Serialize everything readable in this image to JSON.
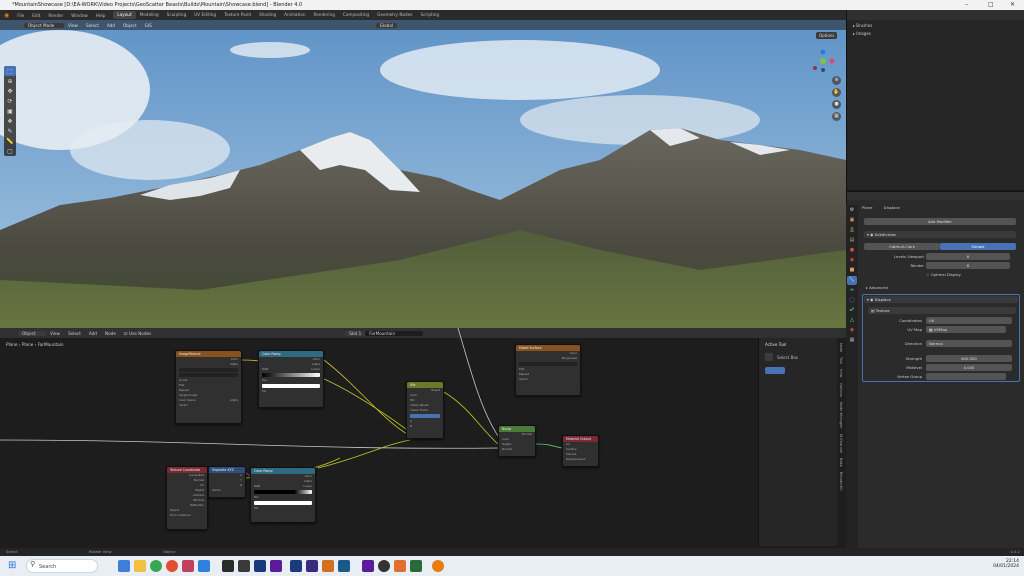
{
  "window": {
    "title": "*MountainShowcase [D:\\EA-WORK\\Video Projects\\GeoScatter Beasts\\Builds\\Mountain\\Showcase.blend] - Blender 4.0"
  },
  "menu": [
    "File",
    "Edit",
    "Render",
    "Window",
    "Help"
  ],
  "workspaces": [
    {
      "label": "Layout",
      "active": true
    },
    {
      "label": "Modeling"
    },
    {
      "label": "Sculpting"
    },
    {
      "label": "UV Editing"
    },
    {
      "label": "Texture Paint"
    },
    {
      "label": "Shading"
    },
    {
      "label": "Animation"
    },
    {
      "label": "Rendering"
    },
    {
      "label": "Compositing"
    },
    {
      "label": "Geometry Nodes"
    },
    {
      "label": "Scripting"
    }
  ],
  "scene": {
    "name": "Scene",
    "view_layer": "ViewLayer"
  },
  "viewport": {
    "mode": "Object Mode",
    "menus": [
      "View",
      "Select",
      "Add",
      "Object"
    ],
    "gis": "GIS",
    "orientation": "Global",
    "options": "Options"
  },
  "node_editor": {
    "type": "Object",
    "menus": [
      "View",
      "Select",
      "Add",
      "Node"
    ],
    "use_nodes": "Use Nodes",
    "slot": "Slot 1",
    "material": "FarMountain",
    "breadcrumb": [
      "Plane",
      "Plane",
      "FarMountain"
    ],
    "nodes": {
      "img": {
        "title": "ImageTexture",
        "rows": [
          "Color",
          "Alpha",
          "Linear",
          "Flat",
          "Repeat",
          "Single Image",
          "Color Space",
          "Alpha",
          "Vector"
        ]
      },
      "ramp1": {
        "title": "Color Ramp",
        "rows": [
          "Color",
          "Alpha",
          "RGB",
          "Linear",
          "Pos",
          "Fac"
        ]
      },
      "mix": {
        "title": "Mix",
        "rows": [
          "Result",
          "Color",
          "Mix",
          "Clamp Result",
          "Clamp Factor",
          "Factor",
          "A",
          "B"
        ]
      },
      "bsdf": {
        "title": "Mixed Surface",
        "rows": [
          "Color",
          "Roughness",
          "Flat",
          "Repeat",
          "Vector"
        ]
      },
      "bump": {
        "title": "Bump",
        "rows": [
          "Normal",
          "Color",
          "Height",
          "Normal"
        ]
      },
      "out": {
        "title": "Material Output",
        "rows": [
          "All",
          "Surface",
          "Volume",
          "Displacement"
        ]
      },
      "texcoord": {
        "title": "Texture Coordinate",
        "rows": [
          "Generated",
          "Normal",
          "UV",
          "Object",
          "Camera",
          "Window",
          "Reflection",
          "Object",
          "From Instancer"
        ]
      },
      "sep": {
        "title": "Separate XYZ",
        "rows": [
          "X",
          "Y",
          "Z",
          "Vector"
        ]
      },
      "ramp2": {
        "title": "Color Ramp",
        "rows": [
          "Color",
          "Alpha",
          "RGB",
          "Linear",
          "Pos",
          "Fac"
        ]
      }
    }
  },
  "npanel": {
    "title": "Active Tool",
    "tool": "Select Box",
    "tabs": [
      "Node",
      "Tool",
      "View",
      "Options",
      "Node Wrangler",
      "M-Channel",
      "Bake",
      "BlenderKit"
    ]
  },
  "outliner": {
    "items": [
      {
        "label": "Brushes"
      },
      {
        "label": "Images"
      }
    ]
  },
  "properties": {
    "breadcrumb": [
      "Plane",
      "Displace"
    ],
    "add_modifier": "Add Modifier",
    "subsurf": {
      "name": "Subdivision",
      "tabs": [
        "Catmull-Clark",
        "Simple"
      ],
      "levels_viewport_label": "Levels Viewport",
      "levels_viewport": "6",
      "render_label": "Render",
      "render": "6",
      "optimal": "Optimal Display",
      "advanced": "Advanced"
    },
    "displace": {
      "name": "Displace",
      "texture": "Texture",
      "coordinates_label": "Coordinates",
      "coordinates": "UV",
      "uvmap_label": "UV Map",
      "uvmap": "UVMap",
      "direction_label": "Direction",
      "direction": "Normal",
      "strength_label": "Strength",
      "strength": "600.000",
      "midlevel_label": "Midlevel",
      "midlevel": "0.000",
      "vgroup_label": "Vertex Group"
    }
  },
  "status": {
    "select": "Select",
    "rotate": "Rotate View",
    "object": "Object",
    "version": "4.0.2"
  },
  "taskbar": {
    "search": "Search",
    "time": "22:14",
    "date": "04/01/2024"
  }
}
